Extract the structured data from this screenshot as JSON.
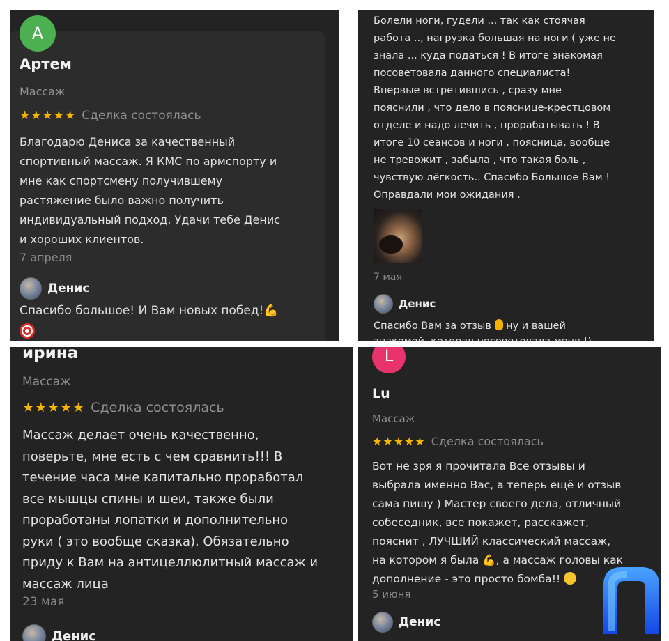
{
  "reviews": [
    {
      "avatar_letter": "A",
      "avatar_color": "#4caf50",
      "name": "Артем",
      "category": "Массаж",
      "stars": "★★★★★",
      "deal_status": "Сделка состоялась",
      "text_lines": [
        "Благодарю Дениса за качественный",
        "спортивный массаж. Я КМС по армспорту и",
        "мне как спортсмену получившему",
        "растяжение было важно получить",
        "индивидуальный подход. Удачи тебе Денис",
        "и хороших клиентов."
      ],
      "date": "7 апреля",
      "owner_name": "Денис",
      "reply_text": "Спасибо большое! И Вам новых побед!",
      "reply_emoji": "flexed-biceps-emoji",
      "reply_emoji_2": "direct-hit-emoji"
    },
    {
      "text_lines": [
        "Болели ноги, гудели  .., так как стоячая",
        "работа .., нагрузка большая на ноги ( уже не",
        "знала .., куда податься ! В итоге знакомая",
        "посоветовала данного специалиста!",
        "Впервые встретившись , сразу мне",
        "пояснили , что дело в пояснице-крестцовом",
        "отделе и надо лечить , прорабатывать ! В",
        "итоге 10 сеансов и ноги , поясница,  вообще",
        "не тревожит  , забыла , что такая боль ,",
        "чувствую лёгкость.. Спасибо Большое Вам !",
        "Оправдали мои ожидания ."
      ],
      "photo": "massage-photo",
      "date": "7 мая",
      "owner_name": "Денис",
      "reply_text": "Спасибо Вам за отзыв",
      "reply_text_2": "ну и вашей",
      "reply_emoji": "ok-hand-emoji",
      "reply_cut_line": "знакомой, которая посоветовала меня !)"
    },
    {
      "name": "ирина",
      "category": "Массаж",
      "stars": "★★★★★",
      "deal_status": "Сделка состоялась",
      "text_lines": [
        "Массаж делает очень качественно,",
        "поверьте, мне есть с чем сравнить!!! В",
        "течение часа мне капитально проработал",
        "все мышцы спины и шеи, также были",
        "проработаны лопатки и дополнительно",
        "руки ( это вообще сказка). Обязательно",
        "приду к Вам на антицеллюлитный массаж и",
        "массаж лица"
      ],
      "date": "23 мая",
      "owner_name": "Денис"
    },
    {
      "avatar_letter": "L",
      "avatar_color": "#e8336d",
      "name": "Lu",
      "category": "Массаж",
      "stars": "★★★★★",
      "deal_status": "Сделка состоялась",
      "text_lines": [
        "Вот не зря я прочитала Все отзывы и",
        "выбрала именно Вас, а теперь ещё и отзыв",
        "сама пишу )  Мастер своего дела, отличный",
        "собеседник, все покажет, расскажет,",
        "пояснит , ЛУЧШИЙ классический массаж,",
        "на котором я была",
        ", а массаж головы как",
        "дополнение - это просто бомба!!"
      ],
      "date": "5 июня",
      "owner_name": "Денис"
    }
  ],
  "brand_logo": "n-shaped-logo",
  "colors": {
    "panel_bg": "#232323",
    "card_bg": "#2c2c2c",
    "star": "#f4b400",
    "logo_blue": "#1f6bff"
  }
}
